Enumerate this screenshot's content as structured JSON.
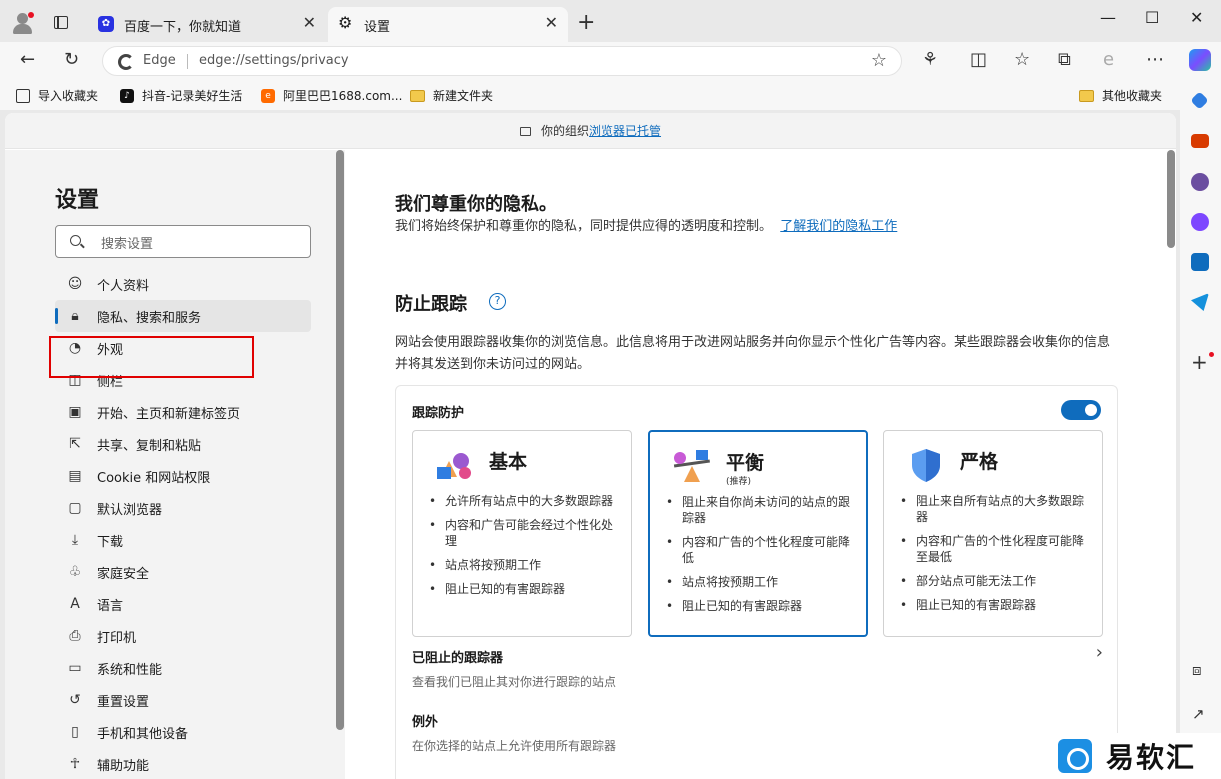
{
  "tabs": [
    {
      "title": "百度一下，你就知道",
      "icon": "baidu-icon"
    },
    {
      "title": "设置",
      "icon": "gear-icon"
    }
  ],
  "address": {
    "brand": "Edge",
    "url": "edge://settings/privacy"
  },
  "favorites": [
    {
      "label": "导入收藏夹",
      "icon": "import-icon"
    },
    {
      "label": "抖音-记录美好生活",
      "icon": "tiktok-icon"
    },
    {
      "label": "阿里巴巴1688.com...",
      "icon": "alibaba-icon"
    },
    {
      "label": "新建文件夹",
      "icon": "folder-icon"
    },
    {
      "label": "其他收藏夹",
      "icon": "folder-icon"
    }
  ],
  "managed": {
    "text": "你的组织",
    "link": "浏览器已托管"
  },
  "sidebar": {
    "title": "设置",
    "search_placeholder": "搜索设置",
    "items": [
      {
        "label": "个人资料",
        "icon": "profile-icon"
      },
      {
        "label": "隐私、搜索和服务",
        "icon": "lock-icon"
      },
      {
        "label": "外观",
        "icon": "palette-icon"
      },
      {
        "label": "侧栏",
        "icon": "sidebar-icon"
      },
      {
        "label": "开始、主页和新建标签页",
        "icon": "home-icon"
      },
      {
        "label": "共享、复制和粘贴",
        "icon": "share-icon"
      },
      {
        "label": "Cookie 和网站权限",
        "icon": "cookie-icon"
      },
      {
        "label": "默认浏览器",
        "icon": "browser-icon"
      },
      {
        "label": "下载",
        "icon": "download-icon"
      },
      {
        "label": "家庭安全",
        "icon": "family-icon"
      },
      {
        "label": "语言",
        "icon": "language-icon"
      },
      {
        "label": "打印机",
        "icon": "printer-icon"
      },
      {
        "label": "系统和性能",
        "icon": "system-icon"
      },
      {
        "label": "重置设置",
        "icon": "reset-icon"
      },
      {
        "label": "手机和其他设备",
        "icon": "phone-icon"
      },
      {
        "label": "辅助功能",
        "icon": "accessibility-icon"
      }
    ]
  },
  "main": {
    "privacy_title": "我们尊重你的隐私。",
    "privacy_desc": "我们将始终保护和尊重你的隐私，同时提供应得的透明度和控制。",
    "privacy_link": "了解我们的隐私工作",
    "tracking_title": "防止跟踪",
    "tracking_desc": "网站会使用跟踪器收集你的浏览信息。此信息将用于改进网站服务并向你显示个性化广告等内容。某些跟踪器会收集你的信息并将其发送到你未访问过的网站。",
    "panel_title": "跟踪防护",
    "toggle_on": true,
    "cards": [
      {
        "name": "基本",
        "sub": "",
        "selected": false,
        "bullets": [
          "允许所有站点中的大多数跟踪器",
          "内容和广告可能会经过个性化处理",
          "站点将按预期工作",
          "阻止已知的有害跟踪器"
        ]
      },
      {
        "name": "平衡",
        "sub": "(推荐)",
        "selected": true,
        "bullets": [
          "阻止来自你尚未访问的站点的跟踪器",
          "内容和广告的个性化程度可能降低",
          "站点将按预期工作",
          "阻止已知的有害跟踪器"
        ]
      },
      {
        "name": "严格",
        "sub": "",
        "selected": false,
        "bullets": [
          "阻止来自所有站点的大多数跟踪器",
          "内容和广告的个性化程度可能降至最低",
          "部分站点可能无法工作",
          "阻止已知的有害跟踪器"
        ]
      }
    ],
    "blocked_title": "已阻止的跟踪器",
    "blocked_desc": "查看我们已阻止其对你进行跟踪的站点",
    "exceptions_title": "例外",
    "exceptions_desc": "在你选择的站点上允许使用所有跟踪器"
  },
  "watermark": "易软汇",
  "colors": {
    "accent": "#0f6cbd",
    "highlight": "#e00000"
  }
}
